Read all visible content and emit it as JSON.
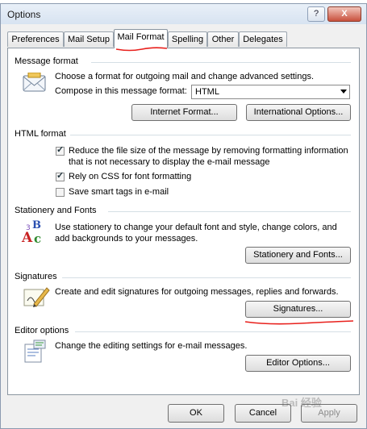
{
  "window": {
    "title": "Options",
    "help_glyph": "?",
    "close_glyph": "X"
  },
  "tabs": [
    {
      "label": "Preferences",
      "active": false
    },
    {
      "label": "Mail Setup",
      "active": false
    },
    {
      "label": "Mail Format",
      "active": true
    },
    {
      "label": "Spelling",
      "active": false
    },
    {
      "label": "Other",
      "active": false
    },
    {
      "label": "Delegates",
      "active": false
    }
  ],
  "message_format": {
    "heading": "Message format",
    "description": "Choose a format for outgoing mail and change advanced settings.",
    "compose_label": "Compose in this message format:",
    "compose_value": "HTML",
    "internet_format_button": "Internet Format...",
    "international_options_button": "International Options..."
  },
  "html_format": {
    "heading": "HTML format",
    "options": [
      {
        "label_line1": "Reduce the file size of the message by removing formatting information",
        "label_line2": "that is not necessary to display the e-mail message",
        "checked": true
      },
      {
        "label_line1": "Rely on CSS for font formatting",
        "checked": true
      },
      {
        "label_line1": "Save smart tags in e-mail",
        "checked": false
      }
    ]
  },
  "stationery": {
    "heading": "Stationery and Fonts",
    "description_line1": "Use stationery to change your default font and style, change colors, and",
    "description_line2": "add backgrounds to your messages.",
    "button": "Stationery and Fonts..."
  },
  "signatures": {
    "heading": "Signatures",
    "description": "Create and edit signatures for outgoing messages, replies and forwards.",
    "button": "Signatures..."
  },
  "editor": {
    "heading": "Editor options",
    "description": "Change the editing settings for e-mail messages.",
    "button": "Editor Options..."
  },
  "footer": {
    "ok": "OK",
    "cancel": "Cancel",
    "apply": "Apply"
  },
  "watermark": "Bai 经验",
  "annotation_color": "#e8201c"
}
